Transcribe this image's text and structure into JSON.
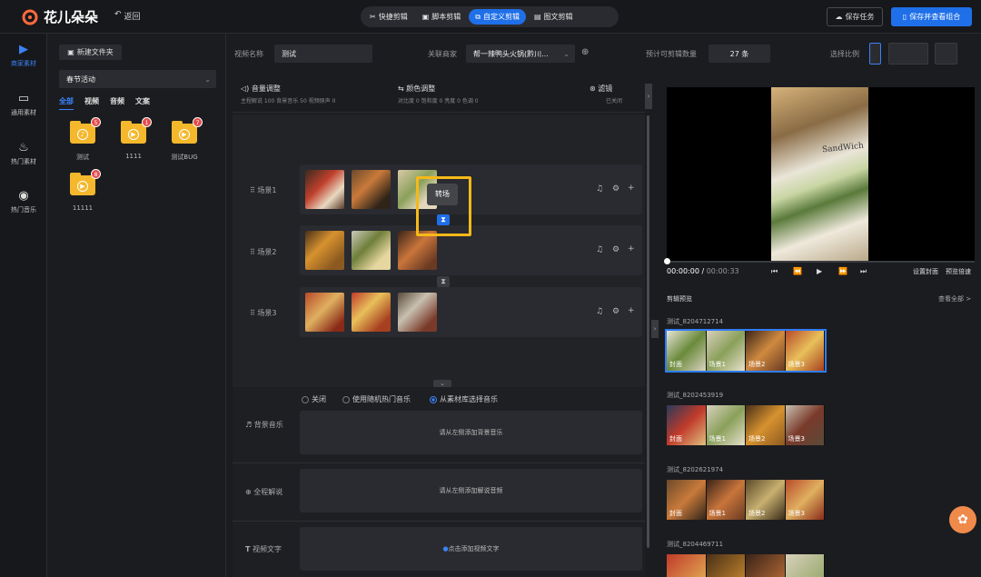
{
  "app": {
    "name": "花儿朵朵",
    "back_label": "返回"
  },
  "modes": [
    {
      "label": "快捷剪辑",
      "icon": "scissors-icon"
    },
    {
      "label": "脚本剪辑",
      "icon": "script-icon"
    },
    {
      "label": "自定义剪辑",
      "icon": "custom-edit-icon",
      "active": true
    },
    {
      "label": "图文剪辑",
      "icon": "image-text-icon"
    }
  ],
  "header": {
    "save_label": "保存任务",
    "save_view_label": "保存并查看组合"
  },
  "rail": [
    {
      "label": "商家素材",
      "active": true
    },
    {
      "label": "通用素材"
    },
    {
      "label": "热门素材"
    },
    {
      "label": "热门音乐"
    }
  ],
  "library": {
    "new_folder": "新建文件夹",
    "category": "春节活动",
    "tabs": [
      "全部",
      "视频",
      "音频",
      "文案"
    ],
    "folders": [
      {
        "name": "测试",
        "badge": "5",
        "kind": "audio"
      },
      {
        "name": "1111",
        "badge": "1",
        "kind": "video"
      },
      {
        "name": "测试BUG",
        "badge": "7",
        "kind": "video"
      },
      {
        "name": "11111",
        "badge": "8",
        "kind": "video"
      }
    ]
  },
  "form": {
    "video_name_label": "视频名称",
    "video_name": "测试",
    "merchant_label": "关联商家",
    "merchant": "帮一辣鸭头火锅(黔川...",
    "estimate_label": "预计可剪辑数量",
    "estimate": "27 条",
    "ratio_label": "选择比例"
  },
  "adjust": {
    "volume": {
      "title": "音量调整",
      "sub": "主程解说 100  背景音乐 50  视频原声 0"
    },
    "color": {
      "title": "颜色调整",
      "sub": "对比度 0      饱和度 0      亮度 0      色调 0"
    },
    "filter": {
      "title": "滤镜",
      "sub": "已关闭"
    }
  },
  "scenes": [
    {
      "label": "场景1"
    },
    {
      "label": "场景2"
    },
    {
      "label": "场景3"
    }
  ],
  "tooltip": "转场",
  "music": {
    "options": [
      "关闭",
      "使用随机热门音乐",
      "从素材库选择音乐"
    ],
    "selected": 2,
    "bg_label": "背景音乐",
    "bg_hint": "请从左侧添加背景音乐",
    "narration_label": "全程解说",
    "narration_hint": "请从左侧添加解说音频",
    "text_label": "视频文字",
    "text_hint": "点击添加视频文字"
  },
  "preview": {
    "time": "00:00:00",
    "duration": "00:00:33",
    "cover_label": "设置封面",
    "speed_label": "预览倍速",
    "section_title": "剪辑预览",
    "view_all": "查看全部 >",
    "sandwich_text": "SandWich"
  },
  "clips": [
    {
      "title": "测试_8204712714",
      "labels": [
        "封面",
        "场景1",
        "场景2",
        "场景3"
      ]
    },
    {
      "title": "测试_8202453919",
      "labels": [
        "封面",
        "场景1",
        "场景2",
        "场景3"
      ]
    },
    {
      "title": "测试_8202621974",
      "labels": [
        "封面",
        "场景1",
        "场景2",
        "场景3"
      ]
    },
    {
      "title": "测试_8204469711",
      "labels": [
        "",
        "",
        "",
        ""
      ]
    }
  ]
}
